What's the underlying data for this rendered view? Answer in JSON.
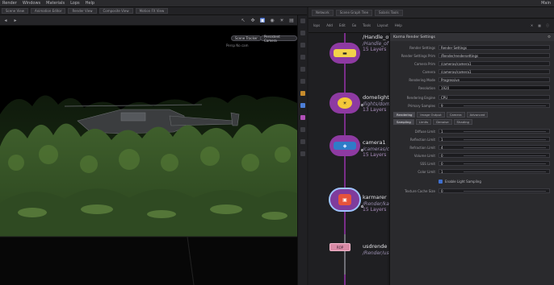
{
  "menubar": {
    "items": [
      "Render",
      "Windows",
      "Materials",
      "Lops",
      "Help"
    ],
    "right_text": "Main"
  },
  "viewport_tabs": [
    "Scene View",
    "Animation Editor",
    "Render View",
    "Composite View",
    "Motion FX View"
  ],
  "viewport": {
    "chip_left": "Scene Tracker",
    "chip_right": "Persistent Camera",
    "meta": "Persp    No cam"
  },
  "right_tabs": [
    "Network",
    "Scene Graph Tree",
    "Solaris Tools"
  ],
  "right_tools": {
    "path": "lops",
    "items": [
      "Add",
      "Edit",
      "Go",
      "Tools",
      "Layout",
      "Help"
    ]
  },
  "graph": {
    "nodes": [
      {
        "name": "/Handle_of_z",
        "context": "/Handle_of",
        "layers": "15 Layers",
        "color": "#f2d24a",
        "icon": "camera-icon"
      },
      {
        "name": "domelight",
        "context": "/lights/domel",
        "layers": "13 Layers",
        "color": "#f4c83a",
        "icon": "light-icon"
      },
      {
        "name": "camera1",
        "context": "/cameras/cam",
        "layers": "15 Layers",
        "color": "#2f7cc8",
        "icon": "camera-icon"
      },
      {
        "name": "karmarer",
        "context": "/Render/karmar",
        "layers": "15 Layers",
        "color": "#e6533b",
        "icon": "render-icon"
      }
    ],
    "usd_node": {
      "name": "usdrende",
      "context": "/Render/usd",
      "label": "ROP"
    }
  },
  "props": {
    "header": "Karma Render Settings",
    "rows": [
      {
        "label": "Render Settings",
        "value": "Render Settings"
      },
      {
        "label": "Render Settings Prim",
        "value": "/Render/rendersettings"
      },
      {
        "label": "Camera Prim",
        "value": "/cameras/camera1"
      },
      {
        "label": "Camera",
        "value": "/cameras/camera1"
      },
      {
        "label": "Rendering Mode",
        "value": "Progressive"
      },
      {
        "label": "Resolution",
        "value": "1920"
      },
      {
        "label": "Rendering Engine",
        "value": "CPU"
      },
      {
        "label": "Primary Samples",
        "value": "9"
      }
    ],
    "tabs_a": [
      "Rendering",
      "Image Output",
      "Camera",
      "Advanced"
    ],
    "tabs_b": [
      "Sampling",
      "Limits",
      "Denoise",
      "Shading"
    ],
    "sample_rows": [
      {
        "label": "Diffuse Limit",
        "value": "1"
      },
      {
        "label": "Reflection Limit",
        "value": "1"
      },
      {
        "label": "Refraction Limit",
        "value": "4"
      },
      {
        "label": "Volume Limit",
        "value": "0"
      },
      {
        "label": "SSS Limit",
        "value": "0"
      },
      {
        "label": "Color Limit",
        "value": "1"
      }
    ],
    "checkbox_label": "Enable Light Sampling",
    "bottom_row": {
      "label": "Texture Cache Size",
      "value": "0"
    }
  }
}
